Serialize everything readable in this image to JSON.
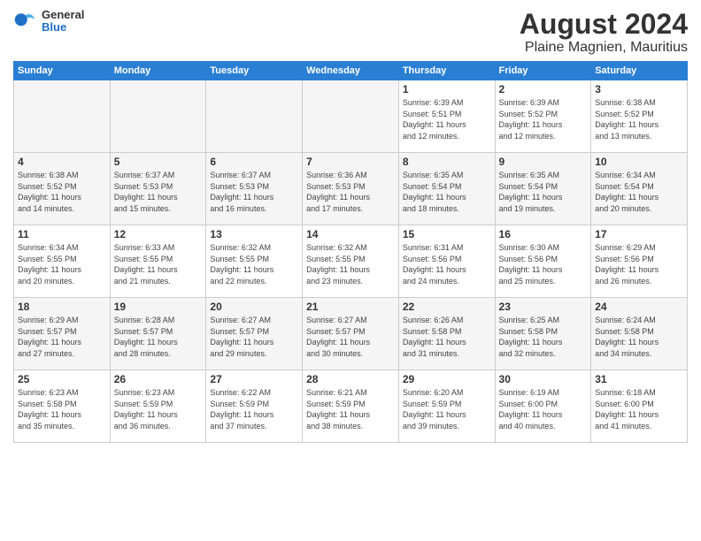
{
  "logo": {
    "general": "General",
    "blue": "Blue"
  },
  "title": {
    "month_year": "August 2024",
    "location": "Plaine Magnien, Mauritius"
  },
  "headers": [
    "Sunday",
    "Monday",
    "Tuesday",
    "Wednesday",
    "Thursday",
    "Friday",
    "Saturday"
  ],
  "weeks": [
    {
      "shaded": false,
      "days": [
        {
          "num": "",
          "info": "",
          "empty": true
        },
        {
          "num": "",
          "info": "",
          "empty": true
        },
        {
          "num": "",
          "info": "",
          "empty": true
        },
        {
          "num": "",
          "info": "",
          "empty": true
        },
        {
          "num": "1",
          "info": "Sunrise: 6:39 AM\nSunset: 5:51 PM\nDaylight: 11 hours\nand 12 minutes.",
          "empty": false
        },
        {
          "num": "2",
          "info": "Sunrise: 6:39 AM\nSunset: 5:52 PM\nDaylight: 11 hours\nand 12 minutes.",
          "empty": false
        },
        {
          "num": "3",
          "info": "Sunrise: 6:38 AM\nSunset: 5:52 PM\nDaylight: 11 hours\nand 13 minutes.",
          "empty": false
        }
      ]
    },
    {
      "shaded": true,
      "days": [
        {
          "num": "4",
          "info": "Sunrise: 6:38 AM\nSunset: 5:52 PM\nDaylight: 11 hours\nand 14 minutes.",
          "empty": false
        },
        {
          "num": "5",
          "info": "Sunrise: 6:37 AM\nSunset: 5:53 PM\nDaylight: 11 hours\nand 15 minutes.",
          "empty": false
        },
        {
          "num": "6",
          "info": "Sunrise: 6:37 AM\nSunset: 5:53 PM\nDaylight: 11 hours\nand 16 minutes.",
          "empty": false
        },
        {
          "num": "7",
          "info": "Sunrise: 6:36 AM\nSunset: 5:53 PM\nDaylight: 11 hours\nand 17 minutes.",
          "empty": false
        },
        {
          "num": "8",
          "info": "Sunrise: 6:35 AM\nSunset: 5:54 PM\nDaylight: 11 hours\nand 18 minutes.",
          "empty": false
        },
        {
          "num": "9",
          "info": "Sunrise: 6:35 AM\nSunset: 5:54 PM\nDaylight: 11 hours\nand 19 minutes.",
          "empty": false
        },
        {
          "num": "10",
          "info": "Sunrise: 6:34 AM\nSunset: 5:54 PM\nDaylight: 11 hours\nand 20 minutes.",
          "empty": false
        }
      ]
    },
    {
      "shaded": false,
      "days": [
        {
          "num": "11",
          "info": "Sunrise: 6:34 AM\nSunset: 5:55 PM\nDaylight: 11 hours\nand 20 minutes.",
          "empty": false
        },
        {
          "num": "12",
          "info": "Sunrise: 6:33 AM\nSunset: 5:55 PM\nDaylight: 11 hours\nand 21 minutes.",
          "empty": false
        },
        {
          "num": "13",
          "info": "Sunrise: 6:32 AM\nSunset: 5:55 PM\nDaylight: 11 hours\nand 22 minutes.",
          "empty": false
        },
        {
          "num": "14",
          "info": "Sunrise: 6:32 AM\nSunset: 5:55 PM\nDaylight: 11 hours\nand 23 minutes.",
          "empty": false
        },
        {
          "num": "15",
          "info": "Sunrise: 6:31 AM\nSunset: 5:56 PM\nDaylight: 11 hours\nand 24 minutes.",
          "empty": false
        },
        {
          "num": "16",
          "info": "Sunrise: 6:30 AM\nSunset: 5:56 PM\nDaylight: 11 hours\nand 25 minutes.",
          "empty": false
        },
        {
          "num": "17",
          "info": "Sunrise: 6:29 AM\nSunset: 5:56 PM\nDaylight: 11 hours\nand 26 minutes.",
          "empty": false
        }
      ]
    },
    {
      "shaded": true,
      "days": [
        {
          "num": "18",
          "info": "Sunrise: 6:29 AM\nSunset: 5:57 PM\nDaylight: 11 hours\nand 27 minutes.",
          "empty": false
        },
        {
          "num": "19",
          "info": "Sunrise: 6:28 AM\nSunset: 5:57 PM\nDaylight: 11 hours\nand 28 minutes.",
          "empty": false
        },
        {
          "num": "20",
          "info": "Sunrise: 6:27 AM\nSunset: 5:57 PM\nDaylight: 11 hours\nand 29 minutes.",
          "empty": false
        },
        {
          "num": "21",
          "info": "Sunrise: 6:27 AM\nSunset: 5:57 PM\nDaylight: 11 hours\nand 30 minutes.",
          "empty": false
        },
        {
          "num": "22",
          "info": "Sunrise: 6:26 AM\nSunset: 5:58 PM\nDaylight: 11 hours\nand 31 minutes.",
          "empty": false
        },
        {
          "num": "23",
          "info": "Sunrise: 6:25 AM\nSunset: 5:58 PM\nDaylight: 11 hours\nand 32 minutes.",
          "empty": false
        },
        {
          "num": "24",
          "info": "Sunrise: 6:24 AM\nSunset: 5:58 PM\nDaylight: 11 hours\nand 34 minutes.",
          "empty": false
        }
      ]
    },
    {
      "shaded": false,
      "days": [
        {
          "num": "25",
          "info": "Sunrise: 6:23 AM\nSunset: 5:58 PM\nDaylight: 11 hours\nand 35 minutes.",
          "empty": false
        },
        {
          "num": "26",
          "info": "Sunrise: 6:23 AM\nSunset: 5:59 PM\nDaylight: 11 hours\nand 36 minutes.",
          "empty": false
        },
        {
          "num": "27",
          "info": "Sunrise: 6:22 AM\nSunset: 5:59 PM\nDaylight: 11 hours\nand 37 minutes.",
          "empty": false
        },
        {
          "num": "28",
          "info": "Sunrise: 6:21 AM\nSunset: 5:59 PM\nDaylight: 11 hours\nand 38 minutes.",
          "empty": false
        },
        {
          "num": "29",
          "info": "Sunrise: 6:20 AM\nSunset: 5:59 PM\nDaylight: 11 hours\nand 39 minutes.",
          "empty": false
        },
        {
          "num": "30",
          "info": "Sunrise: 6:19 AM\nSunset: 6:00 PM\nDaylight: 11 hours\nand 40 minutes.",
          "empty": false
        },
        {
          "num": "31",
          "info": "Sunrise: 6:18 AM\nSunset: 6:00 PM\nDaylight: 11 hours\nand 41 minutes.",
          "empty": false
        }
      ]
    }
  ]
}
